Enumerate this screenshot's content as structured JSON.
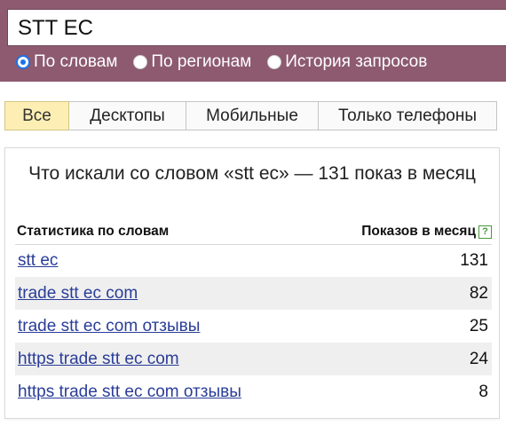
{
  "search": {
    "query": "STT EC"
  },
  "radios": [
    {
      "label": "По словам",
      "checked": true
    },
    {
      "label": "По регионам",
      "checked": false
    },
    {
      "label": "История запросов",
      "checked": false
    }
  ],
  "tabs": [
    {
      "label": "Все",
      "active": true
    },
    {
      "label": "Десктопы",
      "active": false
    },
    {
      "label": "Мобильные",
      "active": false
    },
    {
      "label": "Только телефоны",
      "active": false
    }
  ],
  "panel": {
    "title": "Что искали со словом «stt ec» — 131 показ в месяц",
    "col_words": "Статистика по словам",
    "col_shows": "Показов в месяц",
    "help_icon": "?",
    "rows": [
      {
        "phrase": "stt ec",
        "count": "131"
      },
      {
        "phrase": "trade stt ec com",
        "count": "82"
      },
      {
        "phrase": "trade stt ec com отзывы",
        "count": "25"
      },
      {
        "phrase": "https trade stt ec com",
        "count": "24"
      },
      {
        "phrase": "https trade stt ec com отзывы",
        "count": "8"
      }
    ]
  },
  "colors": {
    "topbar": "#8d5a6f",
    "active_tab": "#fdefb4",
    "link": "#2a3d98",
    "radio_selected": "#1a73e8"
  }
}
